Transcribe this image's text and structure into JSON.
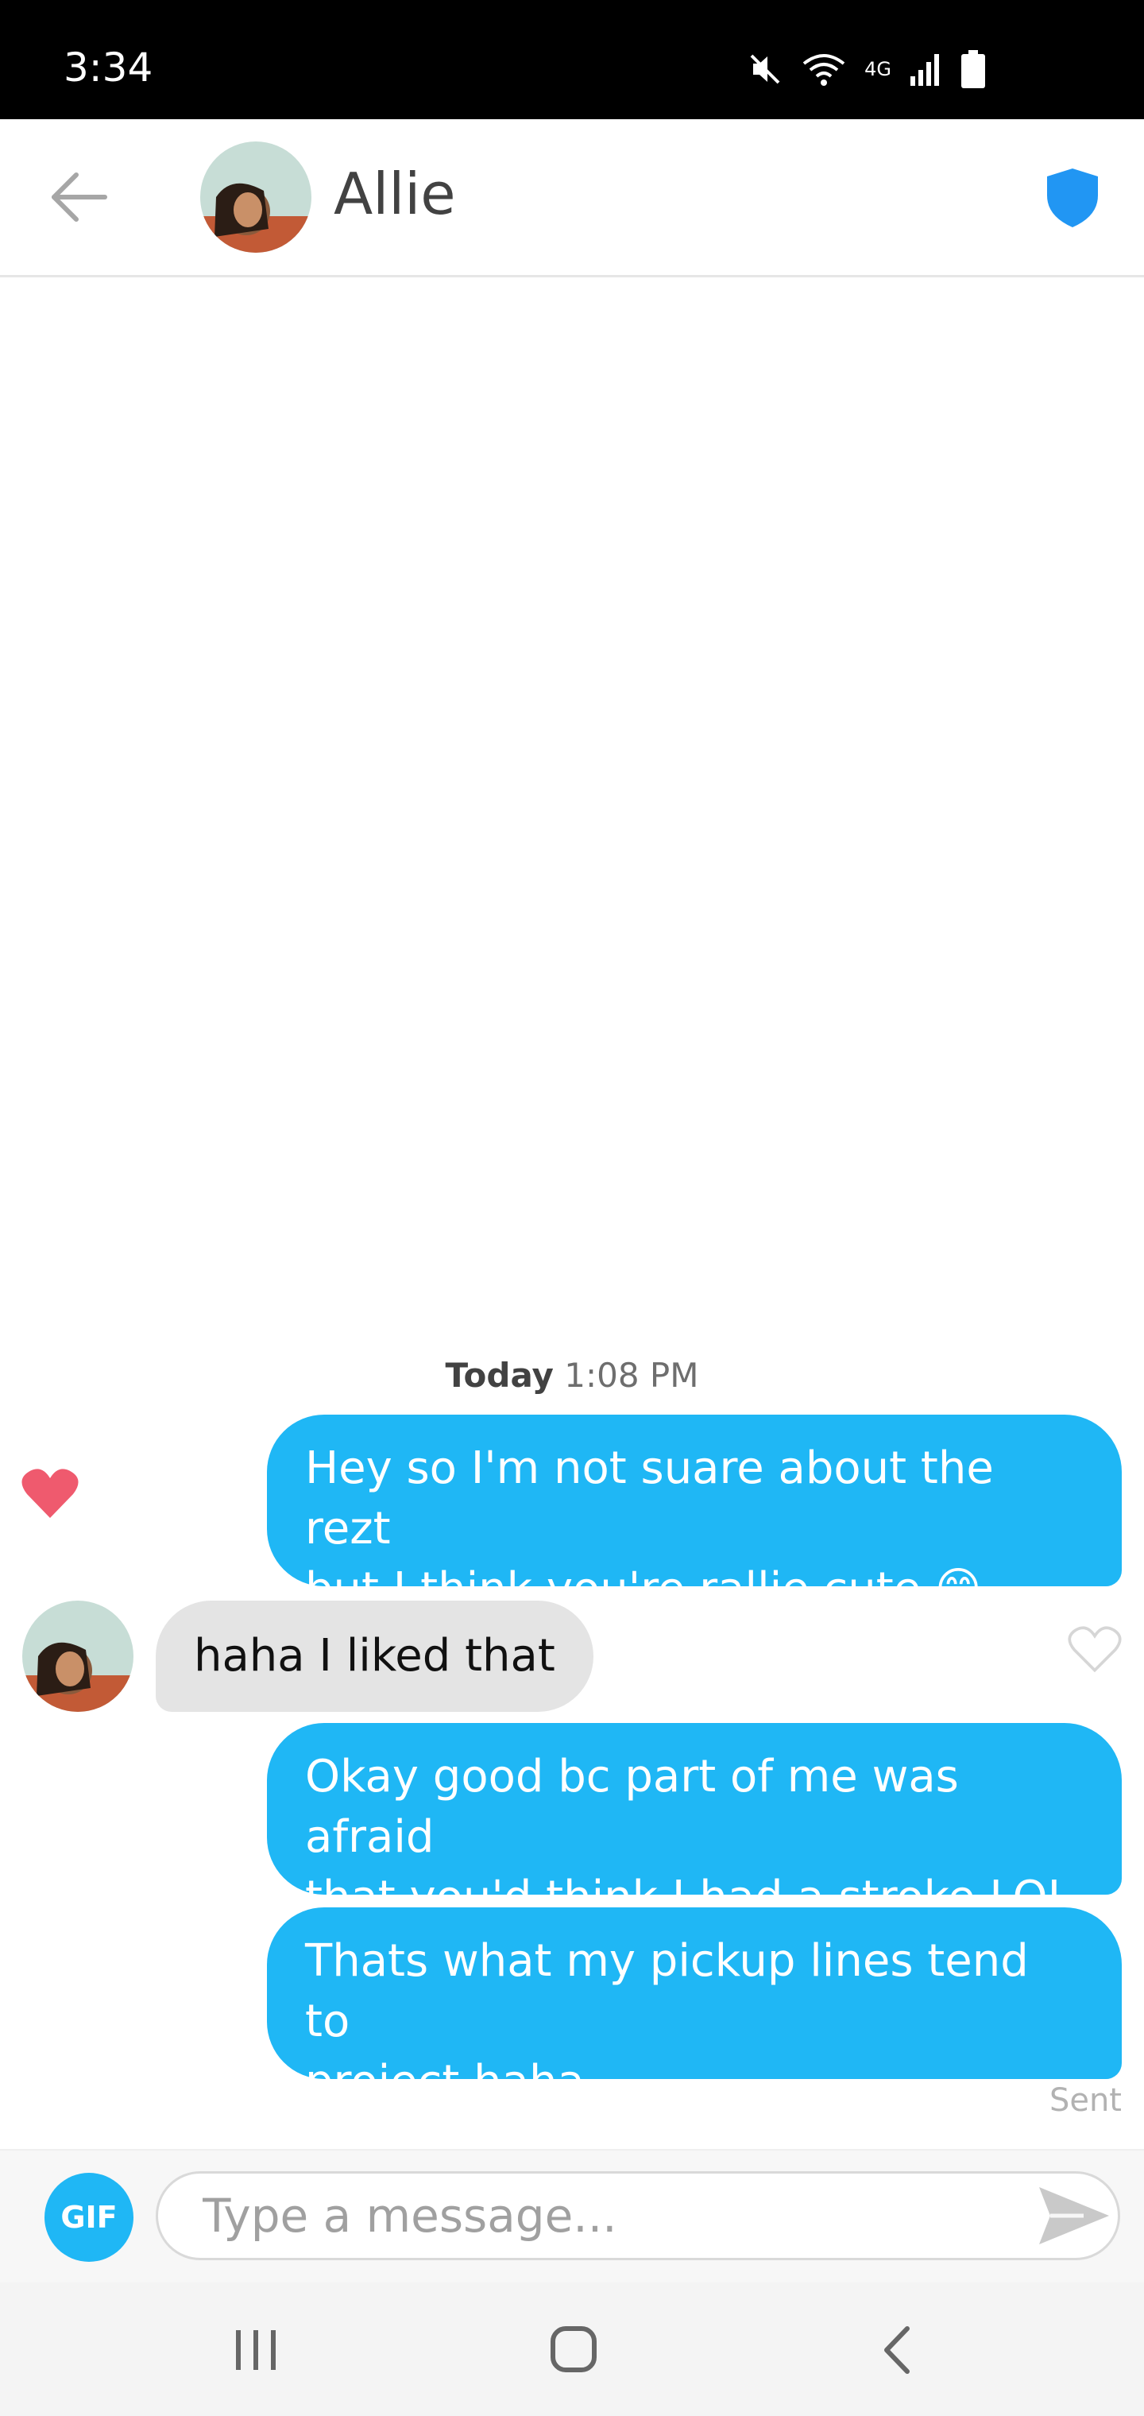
{
  "status_bar": {
    "time": "3:34",
    "network_label": "4G"
  },
  "header": {
    "name": "Allie"
  },
  "chat": {
    "day": "Today",
    "time": "1:08 PM",
    "messages": [
      {
        "direction": "sent",
        "lines": [
          "Hey so I'm not suare about the rezt",
          "but I think you're rallie cute 😊"
        ],
        "liked": true
      },
      {
        "direction": "received",
        "text": "haha I liked that",
        "liked": false
      },
      {
        "direction": "sent",
        "lines": [
          "Okay good bc part of me was afraid",
          "that you'd think I had a stroke LOL"
        ]
      },
      {
        "direction": "sent",
        "lines": [
          "Thats what my pickup lines tend to",
          "project haha"
        ]
      }
    ],
    "status": "Sent"
  },
  "composer": {
    "gif_label": "GIF",
    "placeholder": "Type a message..."
  },
  "icons": {
    "back": "arrow-left-icon",
    "shield": "shield-icon",
    "send": "send-icon",
    "heart_filled": "heart-filled-icon",
    "heart_outline": "heart-outline-icon"
  },
  "colors": {
    "accent": "#1fb7f5",
    "shield": "#2196f3",
    "heart": "#ef5a6e",
    "received_bubble": "#e4e4e4"
  }
}
